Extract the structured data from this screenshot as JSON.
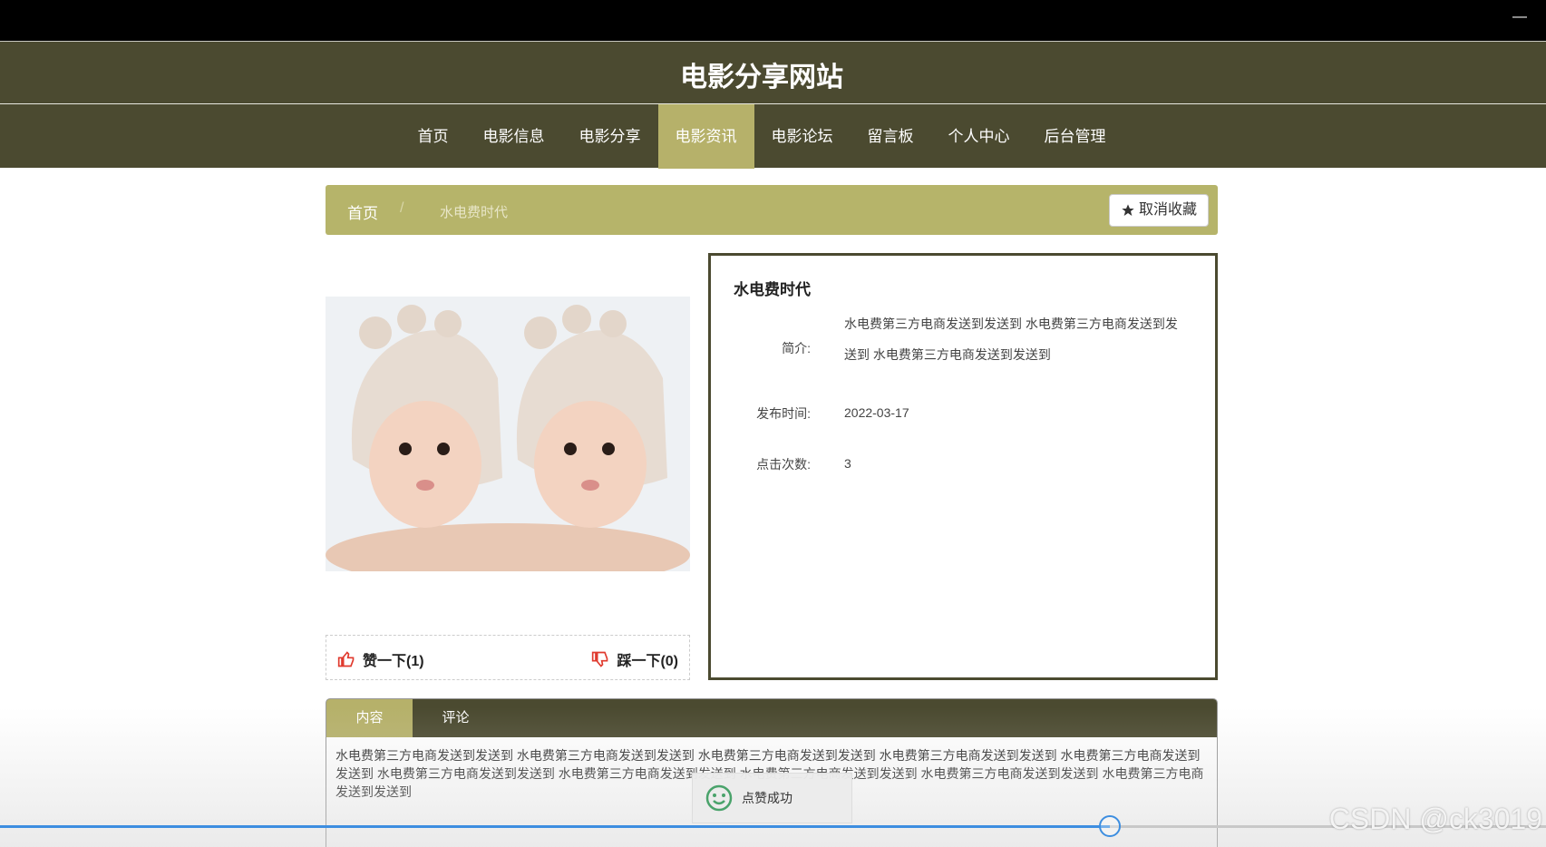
{
  "window": {
    "minimize_label": "—"
  },
  "header": {
    "site_title": "电影分享网站",
    "nav": [
      {
        "label": "首页",
        "active": false
      },
      {
        "label": "电影信息",
        "active": false
      },
      {
        "label": "电影分享",
        "active": false
      },
      {
        "label": "电影资讯",
        "active": true
      },
      {
        "label": "电影论坛",
        "active": false
      },
      {
        "label": "留言板",
        "active": false
      },
      {
        "label": "个人中心",
        "active": false
      },
      {
        "label": "后台管理",
        "active": false
      }
    ]
  },
  "breadcrumb": {
    "home": "首页",
    "separator": "/",
    "current": "水电费时代",
    "fav_button": "取消收藏"
  },
  "detail": {
    "title": "水电费时代",
    "intro_label": "简介:",
    "intro_value": "水电费第三方电商发送到发送到 水电费第三方电商发送到发送到 水电费第三方电商发送到发送到",
    "date_label": "发布时间:",
    "date_value": "2022-03-17",
    "clicks_label": "点击次数:",
    "clicks_value": "3"
  },
  "votes": {
    "like_label": "赞一下(1)",
    "dislike_label": "踩一下(0)"
  },
  "tabs": {
    "content_tab": "内容",
    "comment_tab": "评论",
    "content_text": "水电费第三方电商发送到发送到 水电费第三方电商发送到发送到 水电费第三方电商发送到发送到 水电费第三方电商发送到发送到 水电费第三方电商发送到发送到 水电费第三方电商发送到发送到 水电费第三方电商发送到发送到 水电费第三方电商发送到发送到 水电费第三方电商发送到发送到 水电费第三方电商发送到发送到"
  },
  "toast": {
    "message": "点赞成功"
  },
  "video": {
    "progress": 0.718
  },
  "watermark": "CSDN @ck3019",
  "colors": {
    "header_bg": "#4b4a30",
    "accent": "#b6b16a",
    "progress": "#3d8ee0"
  }
}
